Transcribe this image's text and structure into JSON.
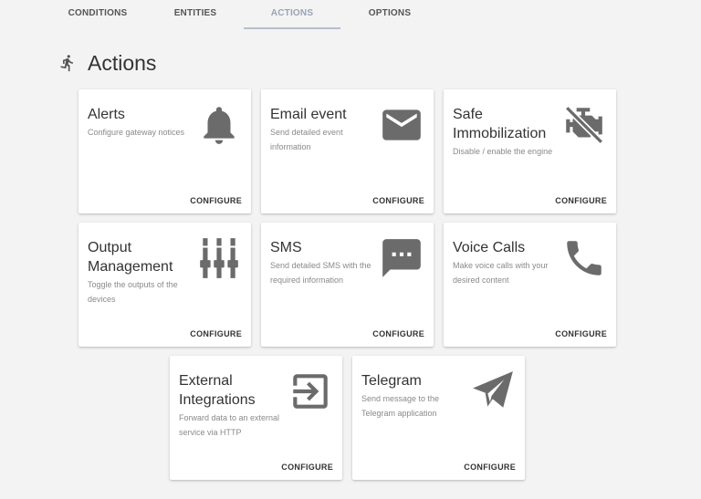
{
  "tabs": [
    {
      "label": "CONDITIONS",
      "active": false
    },
    {
      "label": "ENTITIES",
      "active": false
    },
    {
      "label": "ACTIONS",
      "active": true
    },
    {
      "label": "OPTIONS",
      "active": false
    }
  ],
  "header": {
    "title": "Actions",
    "icon": "running-person-icon"
  },
  "colors": {
    "icon": "#6b6b6b",
    "active_tab": "#9aa4b6",
    "background": "#f3f3f3",
    "card": "#ffffff"
  },
  "cards": [
    {
      "title": "Alerts",
      "description": "Configure gateway notices",
      "button": "CONFIGURE",
      "icon": "bell-icon"
    },
    {
      "title": "Email event",
      "description": "Send detailed event information",
      "button": "CONFIGURE",
      "icon": "envelope-icon"
    },
    {
      "title": "Safe Immobilization",
      "description": "Disable / enable the engine",
      "button": "CONFIGURE",
      "icon": "engine-off-icon"
    },
    {
      "title": "Output Management",
      "description": "Toggle the outputs of the devices",
      "button": "CONFIGURE",
      "icon": "sliders-icon"
    },
    {
      "title": "SMS",
      "description": "Send detailed SMS with the required information",
      "button": "CONFIGURE",
      "icon": "sms-icon"
    },
    {
      "title": "Voice Calls",
      "description": "Make voice calls with your desired content",
      "button": "CONFIGURE",
      "icon": "phone-icon"
    },
    {
      "title": "External Integrations",
      "description": "Forward data to an external service via HTTP",
      "button": "CONFIGURE",
      "icon": "exit-to-app-icon"
    },
    {
      "title": "Telegram",
      "description": "Send message to the Telegram application",
      "button": "CONFIGURE",
      "icon": "paper-plane-icon"
    }
  ]
}
